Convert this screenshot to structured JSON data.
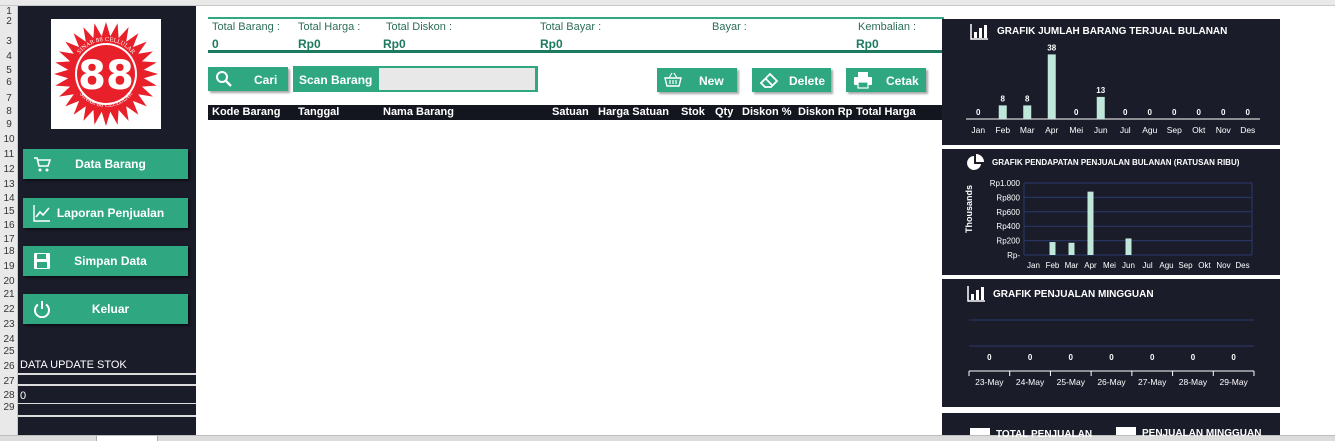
{
  "sheet": {
    "row_numbers": [
      "1",
      "2",
      "3",
      "4",
      "5",
      "6",
      "7",
      "8",
      "9",
      "10",
      "11",
      "12",
      "13",
      "14",
      "15",
      "16",
      "17",
      "18",
      "19",
      "20",
      "21",
      "22",
      "23",
      "24",
      "25",
      "26",
      "27",
      "28",
      "29"
    ]
  },
  "sidebar": {
    "logo": {
      "text": "88",
      "ring_text": "SINAR 88 CELLULAR",
      "color": "#e8202a"
    },
    "items": [
      {
        "label": "Data Barang",
        "icon": "cart-icon"
      },
      {
        "label": "Laporan Penjualan",
        "icon": "line-chart-icon"
      },
      {
        "label": "Simpan Data",
        "icon": "floppy-disk-icon"
      },
      {
        "label": "Keluar",
        "icon": "power-icon"
      }
    ],
    "stock_label": "DATA UPDATE STOK",
    "stock_value": "0"
  },
  "summary": {
    "total_barang_label": "Total Barang :",
    "total_barang_value": "0",
    "total_harga_label": "Total Harga :",
    "total_harga_value": "Rp0",
    "total_diskon_label": "Total Diskon :",
    "total_diskon_value": "Rp0",
    "total_bayar_label": "Total Bayar :",
    "total_bayar_value": "Rp0",
    "bayar_label": "Bayar :",
    "kembalian_label": "Kembalian :",
    "kembalian_value": "Rp0"
  },
  "toolbar": {
    "cari_label": "Cari",
    "scan_label": "Scan Barang",
    "scan_value": "",
    "new_label": "New",
    "delete_label": "Delete",
    "cetak_label": "Cetak"
  },
  "table": {
    "headers": [
      "Kode Barang",
      "Tanggal",
      "Nama Barang",
      "Satuan",
      "Harga Satuan",
      "Stok",
      "Qty",
      "Diskon %",
      "Diskon Rp",
      "Total Harga"
    ]
  },
  "colors": {
    "accent": "#2fa882",
    "panel": "#1a1c2a",
    "bar": "#bfe8da"
  },
  "panels": [
    {
      "title": "GRAFIK JUMLAH BARANG TERJUAL BULANAN",
      "icon": "bar-chart-icon"
    },
    {
      "title": "GRAFIK PENDAPATAN PENJUALAN BULANAN (RATUSAN RIBU)",
      "icon": "pie-chart-icon"
    },
    {
      "title": "GRAFIK PENJUALAN MINGGUAN",
      "icon": "bar-chart-icon"
    },
    {
      "title": "TOTAL PENJUALAN",
      "icon": "money-icon",
      "title2": "PENJUALAN MINGGUAN",
      "icon2": "money-icon"
    }
  ],
  "chart_data": [
    {
      "type": "bar",
      "title": "GRAFIK JUMLAH BARANG TERJUAL BULANAN",
      "categories": [
        "Jan",
        "Feb",
        "Mar",
        "Apr",
        "Mei",
        "Jun",
        "Jul",
        "Agu",
        "Sep",
        "Okt",
        "Nov",
        "Des"
      ],
      "values": [
        0,
        8,
        8,
        38,
        0,
        13,
        0,
        0,
        0,
        0,
        0,
        0
      ],
      "data_labels": true,
      "ylim": [
        0,
        40
      ],
      "grid": false
    },
    {
      "type": "bar",
      "title": "GRAFIK PENDAPATAN PENJUALAN BULANAN (RATUSAN RIBU)",
      "categories": [
        "Jan",
        "Feb",
        "Mar",
        "Apr",
        "Mei",
        "Jun",
        "Jul",
        "Agu",
        "Sep",
        "Okt",
        "Nov",
        "Des"
      ],
      "values": [
        0,
        180,
        170,
        880,
        0,
        230,
        0,
        0,
        0,
        0,
        0,
        0
      ],
      "ylabel": "Thousands",
      "ytick_labels": [
        "Rp-",
        "Rp200",
        "Rp400",
        "Rp600",
        "Rp800",
        "Rp1.000"
      ],
      "ylim": [
        0,
        1000
      ],
      "grid": true
    },
    {
      "type": "bar",
      "title": "GRAFIK PENJUALAN MINGGUAN",
      "categories": [
        "23-May",
        "24-May",
        "25-May",
        "26-May",
        "27-May",
        "28-May",
        "29-May"
      ],
      "values": [
        0,
        0,
        0,
        0,
        0,
        0,
        0
      ],
      "data_labels": true,
      "grid": true
    }
  ]
}
